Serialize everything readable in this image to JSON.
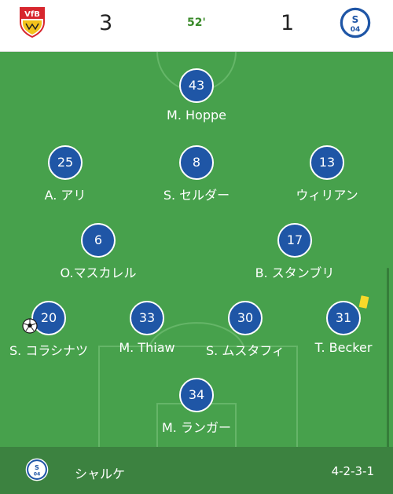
{
  "match": {
    "home_score": "3",
    "away_score": "1",
    "minute": "52'"
  },
  "lineup": {
    "players": [
      {
        "number": "43",
        "name": "M. Hoppe"
      },
      {
        "number": "25",
        "name": "A. アリ"
      },
      {
        "number": "8",
        "name": "S. セルダー"
      },
      {
        "number": "13",
        "name": "ウィリアン"
      },
      {
        "number": "6",
        "name": "O.マスカレル"
      },
      {
        "number": "17",
        "name": "B. スタンブリ"
      },
      {
        "number": "20",
        "name": "S. コラシナツ"
      },
      {
        "number": "33",
        "name": "M. Thiaw"
      },
      {
        "number": "30",
        "name": "S. ムスタフィ"
      },
      {
        "number": "31",
        "name": "T. Becker"
      },
      {
        "number": "34",
        "name": "M. ランガー"
      }
    ]
  },
  "footer": {
    "team_name": "シャルケ",
    "formation": "4-2-3-1"
  },
  "colors": {
    "pitch": "#47a14c",
    "player_circle": "#1f56a6",
    "yellow_card": "#f7d92a",
    "minute_text": "#3a8a2a"
  },
  "icons": {
    "home_logo": "vfb-stuttgart-crest-icon",
    "away_logo": "schalke-04-crest-icon",
    "ball": "soccer-ball-icon",
    "card": "yellow-card-icon"
  }
}
